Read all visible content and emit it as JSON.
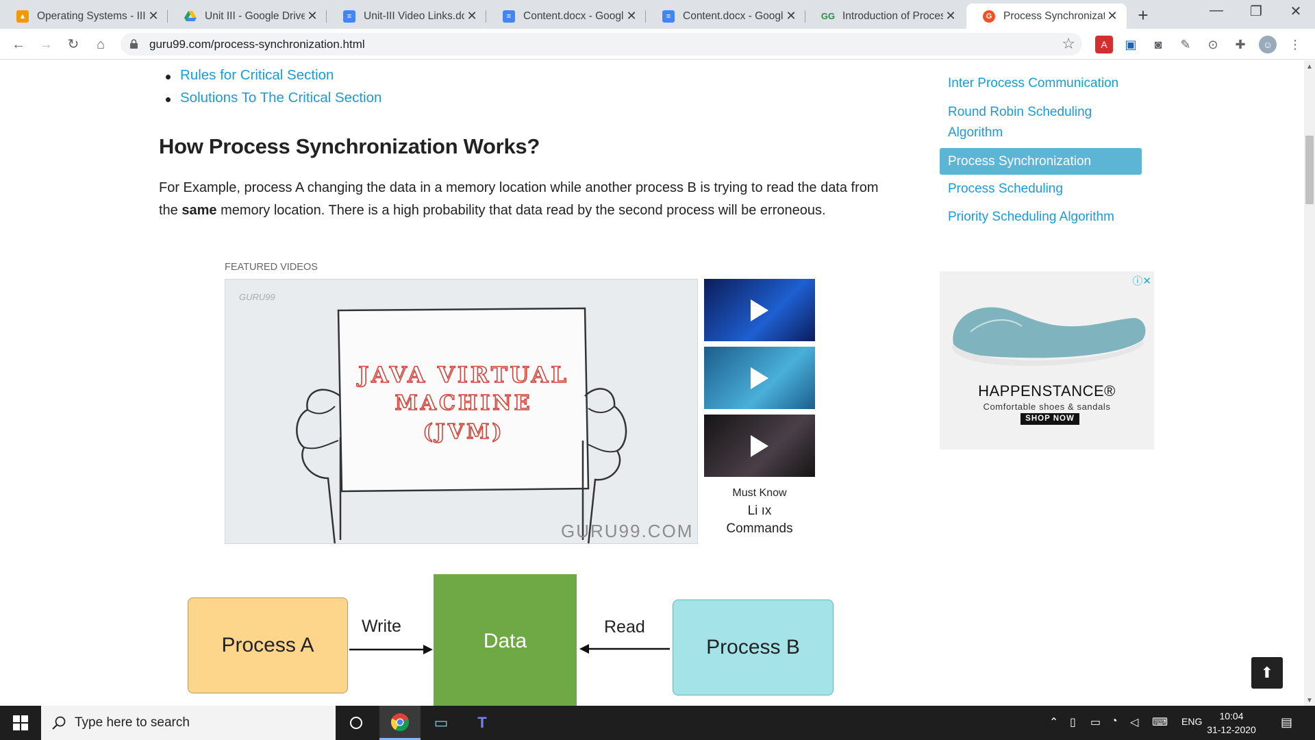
{
  "browser": {
    "tabs": [
      {
        "title": "Operating Systems - III",
        "icon": "classroom-icon",
        "color": "#f29900"
      },
      {
        "title": "Unit III - Google Drive",
        "icon": "google-drive-icon",
        "color": "#1a73e8"
      },
      {
        "title": "Unit-III Video Links.docx",
        "icon": "google-docs-icon",
        "color": "#4285f4"
      },
      {
        "title": "Content.docx - Google Docs",
        "icon": "google-docs-icon",
        "color": "#4285f4"
      },
      {
        "title": "Content.docx - Google Docs",
        "icon": "google-docs-icon",
        "color": "#4285f4"
      },
      {
        "title": "Introduction of Process Synchronization",
        "icon": "geeksforgeeks-icon",
        "color": "#2f8d46"
      },
      {
        "title": "Process Synchronization",
        "icon": "guru99-icon",
        "color": "#f4511e",
        "active": true
      }
    ],
    "close_glyph": "✕",
    "new_tab_glyph": "+",
    "url": "guru99.com/process-synchronization.html"
  },
  "article": {
    "toc_links": [
      "Rules for Critical Section",
      "Solutions To The Critical Section"
    ],
    "heading": "How Process Synchronization Works?",
    "paragraph_before_bold": "For Example, process A changing the data in a memory location while another process B is trying to read the data from the ",
    "paragraph_bold": "same",
    "paragraph_after_bold": " memory location. There is a high probability that data read by the second process will be erroneous.",
    "featured_label": "FEATURED VIDEOS",
    "video": {
      "watermark": "GURU99",
      "board_line1": "JAVA VIRTUAL",
      "board_line2": "MACHINE",
      "board_line3": "(JVM)",
      "brand": "GURU99.COM"
    },
    "thumbs_caption_line1": "Must Know",
    "thumbs_caption_line2": "Li  ıx",
    "thumbs_caption_line3": "Commands",
    "diagram": {
      "process_a": "Process A",
      "data": "Data",
      "process_b": "Process B",
      "write": "Write",
      "read": "Read"
    }
  },
  "sidebar": {
    "links": [
      "Inter Process Communication",
      "Round Robin Scheduling Algorithm",
      "Process Synchronization",
      "Process Scheduling",
      "Priority Scheduling Algorithm"
    ],
    "active": "Process Synchronization"
  },
  "ad": {
    "brand": "HAPPENSTANCE®",
    "tagline": "Comfortable shoes & sandals",
    "button": "SHOP NOW"
  },
  "taskbar": {
    "search_placeholder": "Type here to search",
    "language": "ENG",
    "time": "10:04",
    "date": "31-12-2020"
  }
}
